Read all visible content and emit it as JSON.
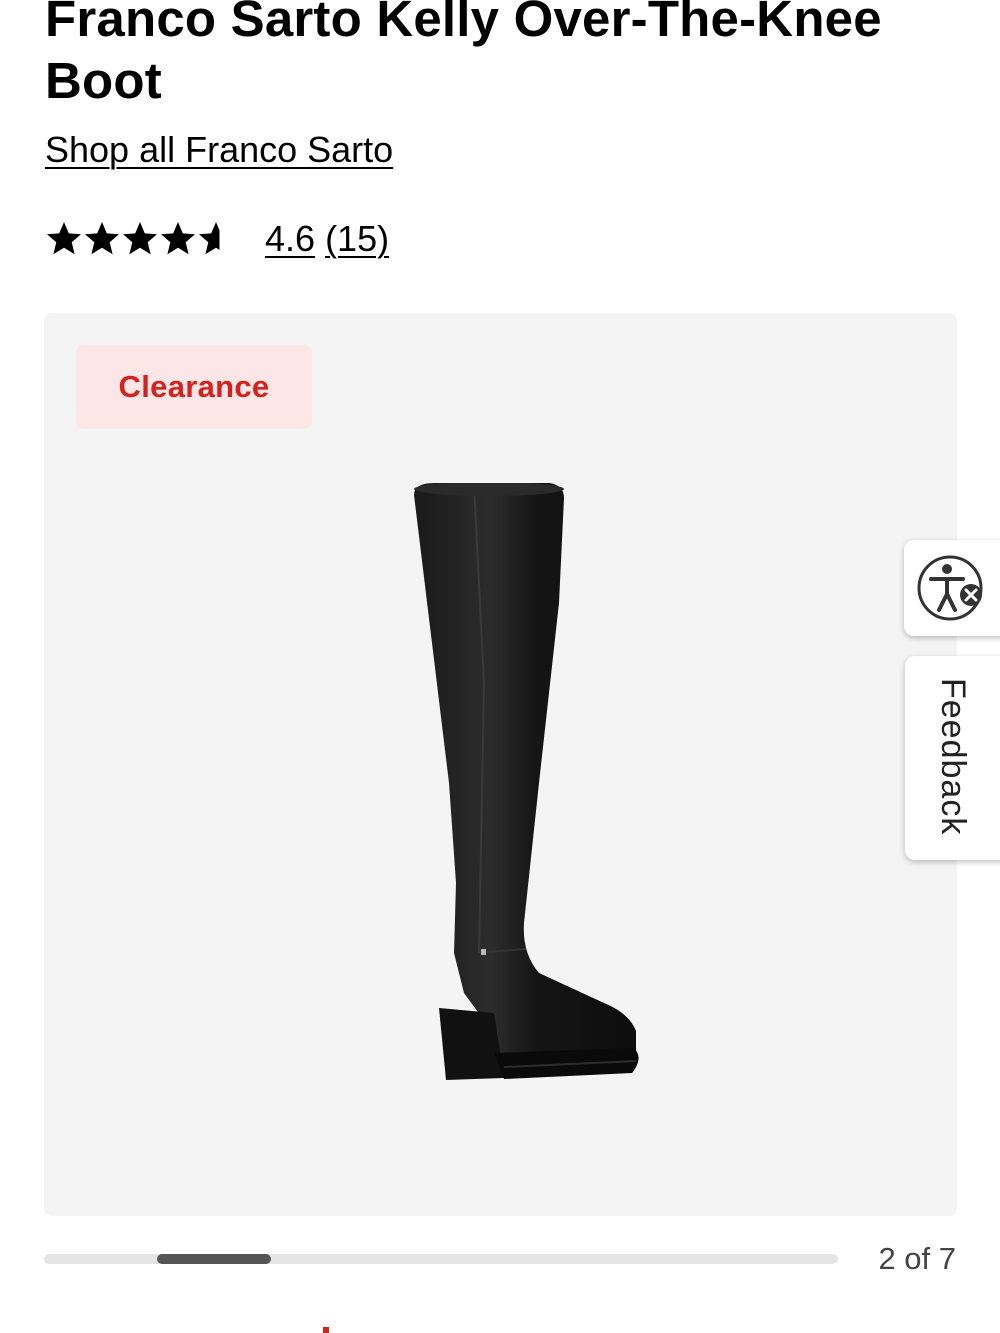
{
  "product": {
    "title": "Franco Sarto Kelly Over-The-Knee Boot",
    "brand_link": "Shop all Franco Sarto"
  },
  "rating": {
    "stars_value": 4.6,
    "stars_max": 5,
    "score_text": "4.6",
    "count_text": "(15)"
  },
  "gallery": {
    "badge": "Clearance",
    "counter": "2 of 7",
    "current_index": 2,
    "total": 7,
    "badge_color": "#d2231f"
  },
  "side_tabs": {
    "accessibility_icon": "accessibility-icon",
    "feedback_label": "Feedback"
  }
}
